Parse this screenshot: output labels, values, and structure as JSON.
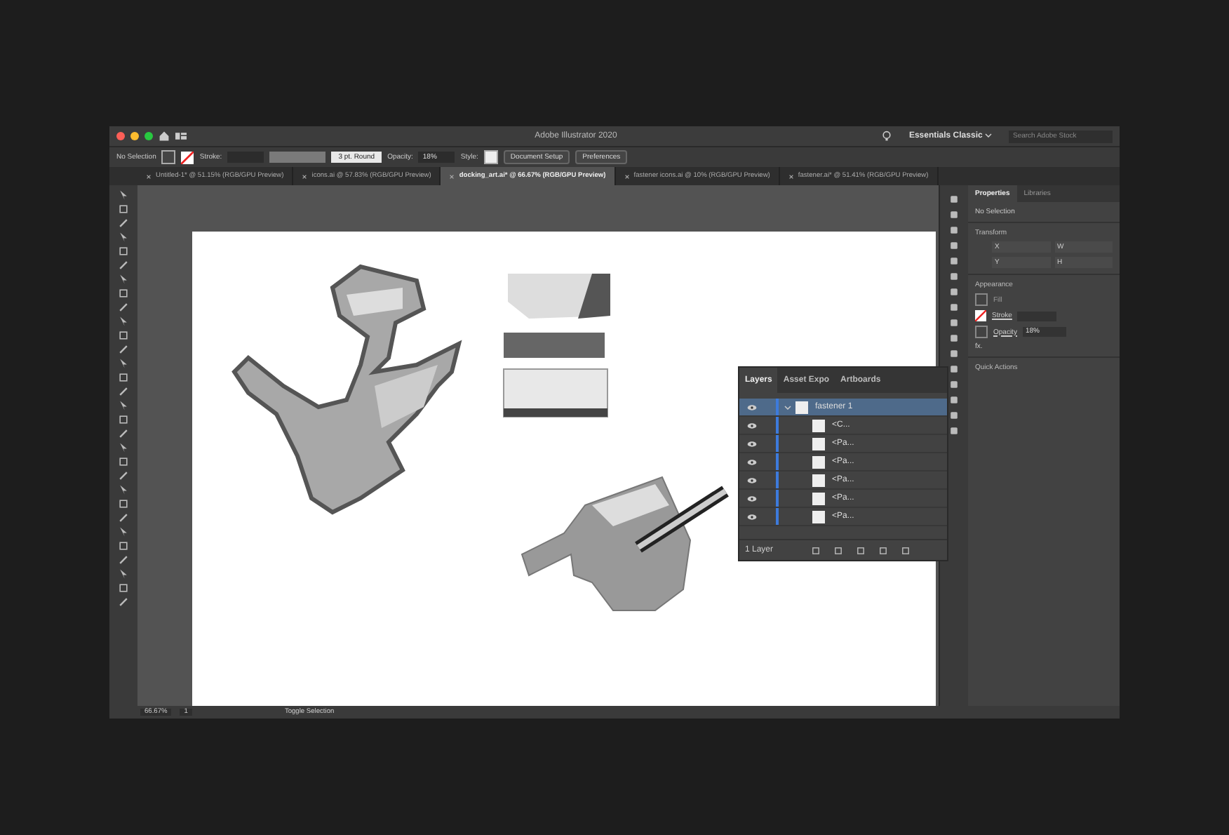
{
  "window": {
    "title": "Adobe Illustrator 2020",
    "workspace": "Essentials Classic",
    "search": {
      "placeholder": "Search Adobe Stock"
    }
  },
  "control_bar": {
    "selection": "No Selection",
    "stroke_label": "Stroke:",
    "brush": "3 pt. Round",
    "opacity_label": "Opacity:",
    "opacity": "18%",
    "style_label": "Style:",
    "buttons": [
      "Document Setup",
      "Preferences"
    ]
  },
  "tabs": [
    {
      "label": "Untitled-1* @ 51.15% (RGB/GPU Preview)",
      "selected": false
    },
    {
      "label": "icons.ai @ 57.83% (RGB/GPU Preview)",
      "selected": false
    },
    {
      "label": "docking_art.ai* @ 66.67% (RGB/GPU Preview)",
      "selected": true
    },
    {
      "label": "fastener icons.ai @ 10% (RGB/GPU Preview)",
      "selected": false
    },
    {
      "label": "fastener.ai* @ 51.41% (RGB/GPU Preview)",
      "selected": false
    }
  ],
  "properties": {
    "tabs": [
      {
        "label": "Properties",
        "selected": true
      },
      {
        "label": "Libraries",
        "selected": false
      }
    ],
    "selection": "No Selection",
    "transform": {
      "title": "Transform",
      "fields": [
        "X",
        "W",
        "Y",
        "H"
      ]
    },
    "appearance": {
      "title": "Appearance",
      "fill": "Fill",
      "stroke": "Stroke",
      "opacity_label": "Opacity",
      "opacity": "18%",
      "fx": "fx."
    },
    "quick_actions": "Quick Actions"
  },
  "layers_panel": {
    "tabs": [
      {
        "label": "Layers",
        "selected": true
      },
      {
        "label": "Asset Expo",
        "selected": false
      },
      {
        "label": "Artboards",
        "selected": false
      }
    ],
    "rows": [
      {
        "name": "fastener 1",
        "visible": true,
        "selected": true,
        "expanded": true,
        "children": [
          {
            "name": "<C...",
            "visible": true,
            "selected": false
          },
          {
            "name": "<Pa...",
            "visible": true,
            "selected": false
          },
          {
            "name": "<Pa...",
            "visible": true,
            "selected": false
          },
          {
            "name": "<Pa...",
            "visible": true,
            "selected": false
          },
          {
            "name": "<Pa...",
            "visible": true,
            "selected": false
          },
          {
            "name": "<Pa...",
            "visible": true,
            "selected": false
          }
        ]
      }
    ],
    "count": "1 Layer"
  },
  "status_bar": {
    "zoom": "66.67%",
    "page": "1",
    "tool": "Toggle Selection"
  }
}
